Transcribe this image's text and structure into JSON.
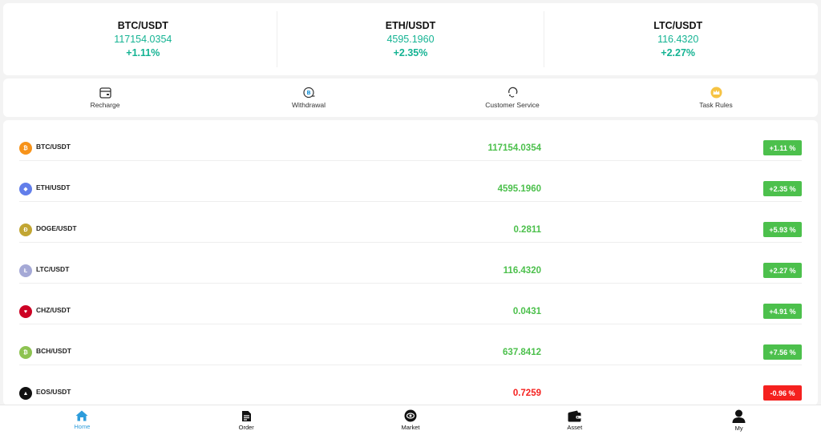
{
  "tickers": [
    {
      "pair": "BTC/USDT",
      "price": "117154.0354",
      "change": "+1.11%"
    },
    {
      "pair": "ETH/USDT",
      "price": "4595.1960",
      "change": "+2.35%"
    },
    {
      "pair": "LTC/USDT",
      "price": "116.4320",
      "change": "+2.27%"
    }
  ],
  "actions": [
    {
      "label": "Recharge",
      "icon": "wallet-icon"
    },
    {
      "label": "Withdrawal",
      "icon": "withdrawal-icon"
    },
    {
      "label": "Customer Service",
      "icon": "headset-icon"
    },
    {
      "label": "Task Rules",
      "icon": "crown-icon"
    }
  ],
  "coins": [
    {
      "pair": "BTC/USDT",
      "price": "117154.0354",
      "change": "+1.11 %",
      "icon": "bitcoin-icon",
      "icon_color": "#f7931a",
      "glyph": "₿",
      "trend": "up"
    },
    {
      "pair": "ETH/USDT",
      "price": "4595.1960",
      "change": "+2.35 %",
      "icon": "ethereum-icon",
      "icon_color": "#627eea",
      "glyph": "◆",
      "trend": "up"
    },
    {
      "pair": "DOGE/USDT",
      "price": "0.2811",
      "change": "+5.93 %",
      "icon": "dogecoin-icon",
      "icon_color": "#c2a633",
      "glyph": "Ð",
      "trend": "up"
    },
    {
      "pair": "LTC/USDT",
      "price": "116.4320",
      "change": "+2.27 %",
      "icon": "litecoin-icon",
      "icon_color": "#a5a9d6",
      "glyph": "Ł",
      "trend": "up"
    },
    {
      "pair": "CHZ/USDT",
      "price": "0.0431",
      "change": "+4.91 %",
      "icon": "chiliz-icon",
      "icon_color": "#cd0124",
      "glyph": "♥",
      "trend": "up"
    },
    {
      "pair": "BCH/USDT",
      "price": "637.8412",
      "change": "+7.56 %",
      "icon": "bitcoin-cash-icon",
      "icon_color": "#8dc351",
      "glyph": "₿",
      "trend": "up"
    },
    {
      "pair": "EOS/USDT",
      "price": "0.7259",
      "change": "-0.96 %",
      "icon": "eos-icon",
      "icon_color": "#111111",
      "glyph": "▲",
      "trend": "down"
    }
  ],
  "colors": {
    "up": "#4cc04c",
    "down": "#f5211f",
    "accent": "#2d9cdb",
    "ticker_green": "#14b393"
  },
  "nav": [
    {
      "label": "Home",
      "icon": "home-icon",
      "active": true
    },
    {
      "label": "Order",
      "icon": "document-icon",
      "active": false
    },
    {
      "label": "Market",
      "icon": "market-icon",
      "active": false
    },
    {
      "label": "Asset",
      "icon": "wallet-icon",
      "active": false
    },
    {
      "label": "My",
      "icon": "user-icon",
      "active": false
    }
  ]
}
